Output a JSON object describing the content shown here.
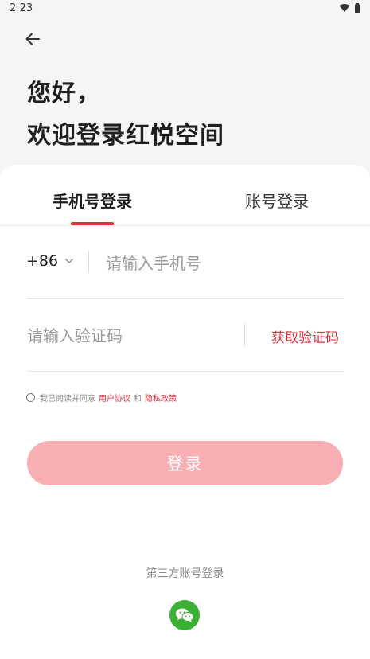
{
  "status": {
    "time": "2:23"
  },
  "greeting": {
    "line1": "您好，",
    "line2": "欢迎登录红悦空间"
  },
  "tabs": [
    {
      "label": "手机号登录",
      "active": true
    },
    {
      "label": "账号登录",
      "active": false
    }
  ],
  "phone": {
    "country_code": "+86",
    "placeholder": "请输入手机号",
    "value": ""
  },
  "code": {
    "placeholder": "请输入验证码",
    "value": "",
    "get_code_label": "获取验证码"
  },
  "agreement": {
    "prefix": "我已阅读并同意",
    "user_agreement": "用户协议",
    "and": "和",
    "privacy_policy": "隐私政策",
    "checked": false
  },
  "login_button": {
    "label": "登录"
  },
  "third_party": {
    "label": "第三方账号登录",
    "providers": [
      "wechat-icon"
    ]
  },
  "colors": {
    "accent": "#e0303c",
    "button_disabled": "#f8b0b4",
    "wechat": "#3cb034",
    "background": "#f5f5f5"
  }
}
